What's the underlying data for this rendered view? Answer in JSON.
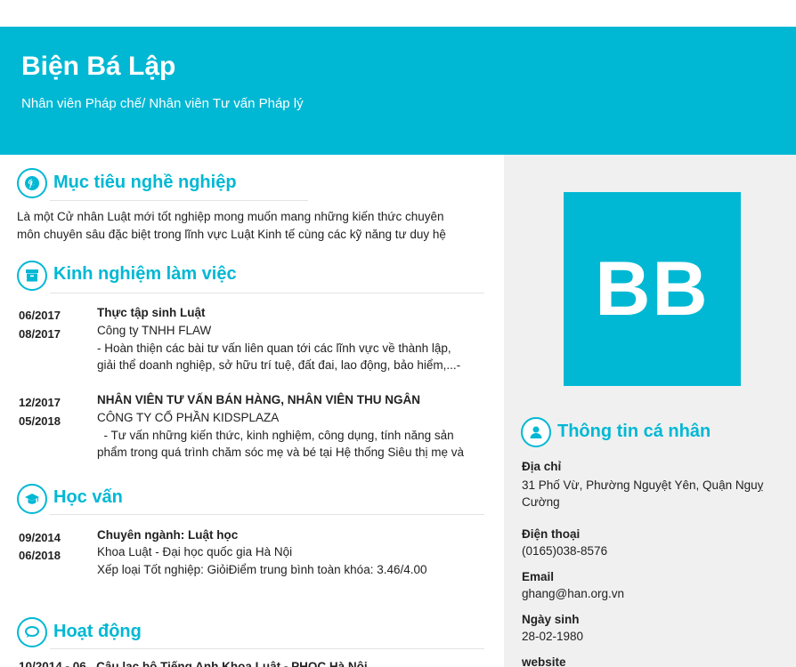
{
  "header": {
    "name": "Biện Bá Lập",
    "job_title": "Nhân viên Pháp chế/ Nhân viên Tư vấn Pháp lý"
  },
  "avatar": {
    "initials": "BB"
  },
  "colors": {
    "accent": "#00b8d4",
    "sidebar_bg": "#f0f0f0"
  },
  "objective": {
    "title": "Mục tiêu nghề nghiệp",
    "icon": "pinterest-icon",
    "lines": [
      "Là một Cử nhân Luật mới tốt nghiệp mong muốn mang những kiến thức chuyên",
      "môn chuyên sâu đặc biệt trong lĩnh vực Luật Kinh tế cùng các kỹ năng tư duy hệ"
    ]
  },
  "experience": {
    "title": "Kinh nghiệm làm việc",
    "icon": "archive-icon",
    "items": [
      {
        "start": "06/2017",
        "end": "08/2017",
        "position": "Thực tập sinh Luật",
        "company": "Công ty TNHH FLAW",
        "desc": [
          "- Hoàn thiện các bài tư vấn liên quan tới các lĩnh vực về thành lập,",
          "giải thể doanh nghiệp, sở hữu trí tuệ, đất đai, lao động, bảo hiểm,...-"
        ]
      },
      {
        "start": "12/2017",
        "end": "05/2018",
        "position": "NHÂN VIÊN TƯ VẤN BÁN HÀNG, NHÂN VIÊN THU NGÂN",
        "company": "CÔNG TY CỔ PHẦN KIDSPLAZA",
        "desc": [
          "  - Tư vấn những kiến thức, kinh nghiệm, công dụng, tính năng sản",
          "phẩm trong quá trình chăm sóc mẹ và bé tại Hệ thống Siêu thị mẹ và"
        ]
      }
    ]
  },
  "education": {
    "title": "Học vấn",
    "icon": "graduation-cap-icon",
    "items": [
      {
        "start": "09/2014",
        "end": "06/2018",
        "major": "Chuyên ngành: Luật học",
        "school": "Khoa Luật - Đại học quốc gia Hà Nội",
        "grade": "Xếp loại Tốt nghiệp: GiỏiĐiểm trung bình toàn khóa: 3.46/4.00"
      }
    ]
  },
  "activities": {
    "title": "Hoạt động",
    "icon": "speech-bubble-icon",
    "partial_line": "10/2014 - 06   Câu lạc bộ Tiếng Anh Khoa Luật - PHOC Hà Nội"
  },
  "personal": {
    "title": "Thông tin cá nhân",
    "icon": "user-icon",
    "address_label": "Địa chỉ",
    "address_line1": "31 Phố Vừ, Phường Nguyệt Yên, Quận Nguỵ",
    "address_line2": "Cường",
    "phone_label": "Điện thoại",
    "phone": "(0165)038-8576",
    "email_label": "Email",
    "email": "ghang@han.org.vn",
    "dob_label": "Ngày sinh",
    "dob": "28-02-1980",
    "website_label": "website"
  }
}
